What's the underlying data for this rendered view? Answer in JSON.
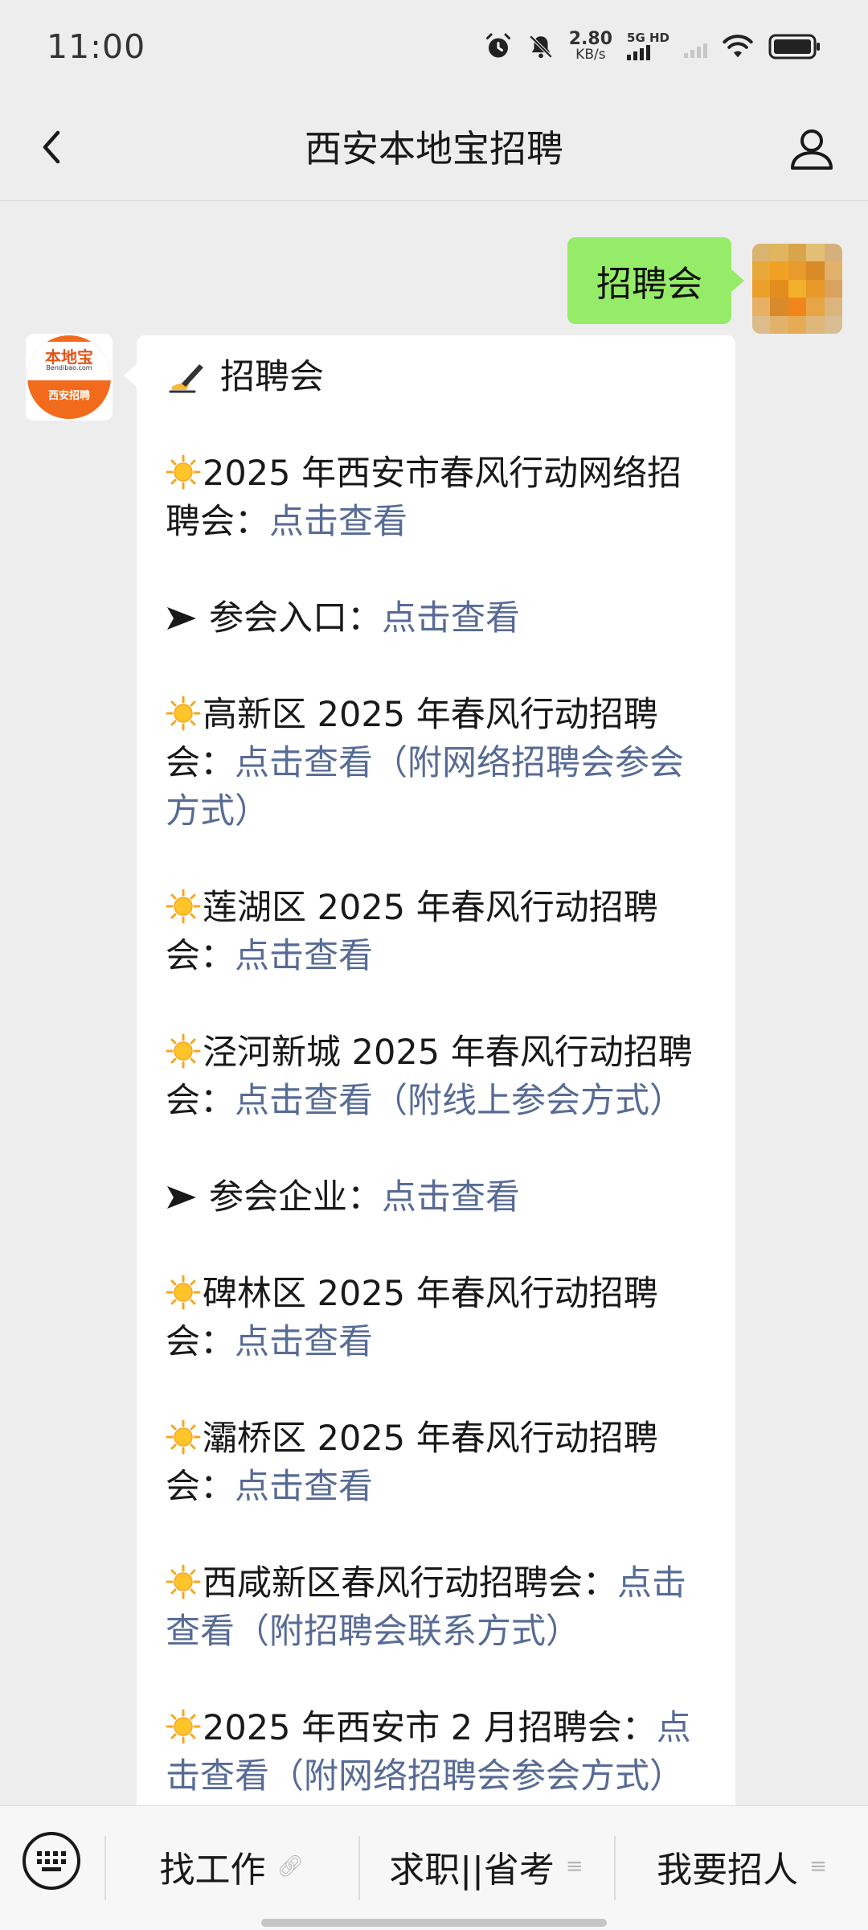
{
  "status": {
    "time": "11:00",
    "net_speed_value": "2.80",
    "net_speed_unit": "KB/s",
    "net_type": "5G HD"
  },
  "nav": {
    "title": "西安本地宝招聘",
    "back_icon": "chevron-left-icon",
    "profile_icon": "person-icon"
  },
  "sent": {
    "text": "招聘会"
  },
  "bot_logo": {
    "main": "本地宝",
    "sub": "Bendibao.com",
    "bottom": "西安招聘"
  },
  "reply": {
    "heading": "招聘会",
    "items": [
      {
        "text": "2025 年西安市春风行动网络招聘会：",
        "link": "点击查看"
      },
      {
        "text": "参会入口：",
        "link": "点击查看"
      },
      {
        "text": "高新区 2025 年春风行动招聘会：",
        "link": "点击查看（附网络招聘会参会方式）"
      },
      {
        "text": "莲湖区 2025 年春风行动招聘会：",
        "link": "点击查看"
      },
      {
        "text": "泾河新城 2025 年春风行动招聘会：",
        "link": "点击查看（附线上参会方式）"
      },
      {
        "text": "参会企业：",
        "link": "点击查看"
      },
      {
        "text": "碑林区 2025 年春风行动招聘会：",
        "link": "点击查看"
      },
      {
        "text": "灞桥区 2025 年春风行动招聘会：",
        "link": "点击查看"
      },
      {
        "text": "西咸新区春风行动招聘会：",
        "link": "点击查看（附招聘会联系方式）"
      },
      {
        "text": "2025 年西安市 2 月招聘会：",
        "link": "点击查看（附网络招聘会参会方式）"
      }
    ]
  },
  "menu": {
    "item1": "找工作",
    "item2": "求职||省考",
    "item3": "我要招人"
  },
  "colors": {
    "sent_bubble": "#95ec69",
    "link": "#576b95",
    "background": "#ededed"
  }
}
